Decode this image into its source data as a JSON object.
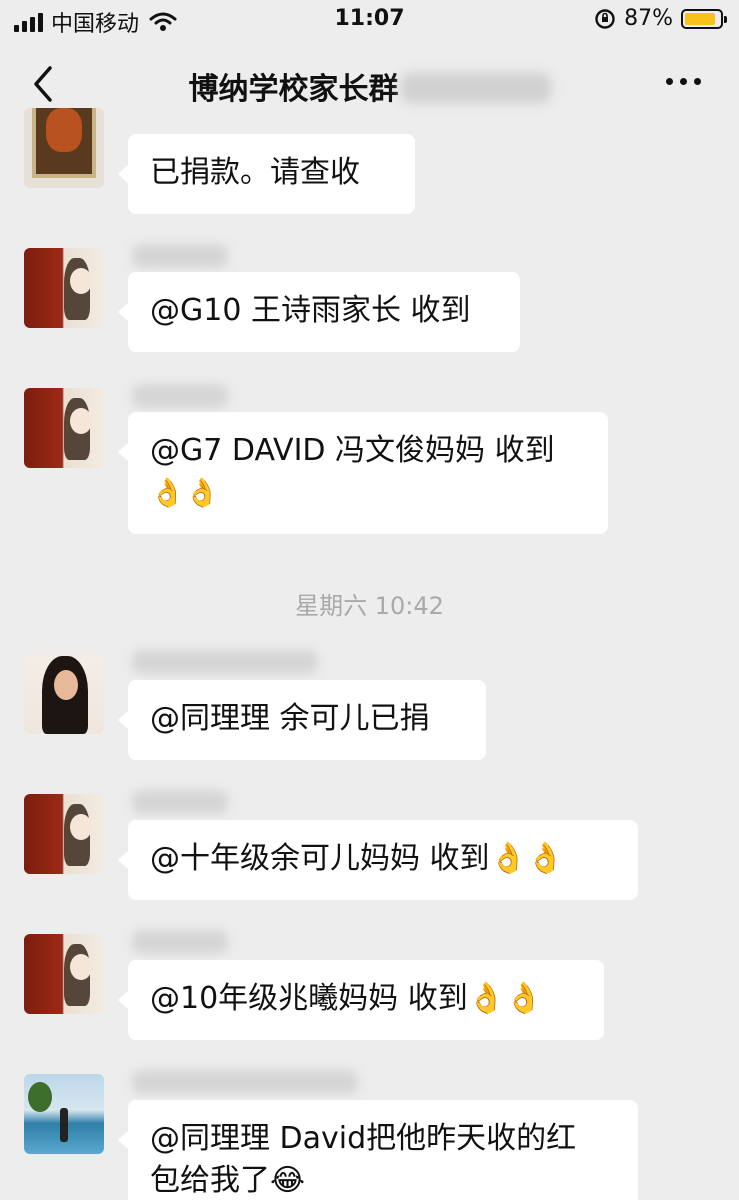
{
  "status_bar": {
    "carrier": "中国移动",
    "time": "11:07",
    "battery": "87%",
    "battery_level": 0.87
  },
  "nav": {
    "title": "博纳学校家长群"
  },
  "messages": [
    {
      "text": "已捐款。请查收"
    },
    {
      "text": "@G10 王诗雨家长 收到"
    },
    {
      "text": "@G7 DAVID 冯文俊妈妈 收到",
      "text2": "👌👌"
    },
    {
      "text": "@同理理 余可儿已捐"
    },
    {
      "text": "@十年级余可儿妈妈 收到👌👌"
    },
    {
      "text": "@10年级兆曦妈妈 收到👌👌"
    },
    {
      "text": "@同理理 David把他昨天收的红",
      "text2": "包给我了😂"
    }
  ],
  "timestamp": "星期六 10:42",
  "icons": {
    "back": "chevron-left-icon",
    "more": "more-dots-icon",
    "wifi": "wifi-icon",
    "signal": "signal-icon",
    "rotation_lock": "rotation-lock-icon",
    "battery": "battery-icon"
  },
  "colors": {
    "background": "#ededed",
    "bubble": "#ffffff",
    "battery_fill": "#f7c31a"
  }
}
